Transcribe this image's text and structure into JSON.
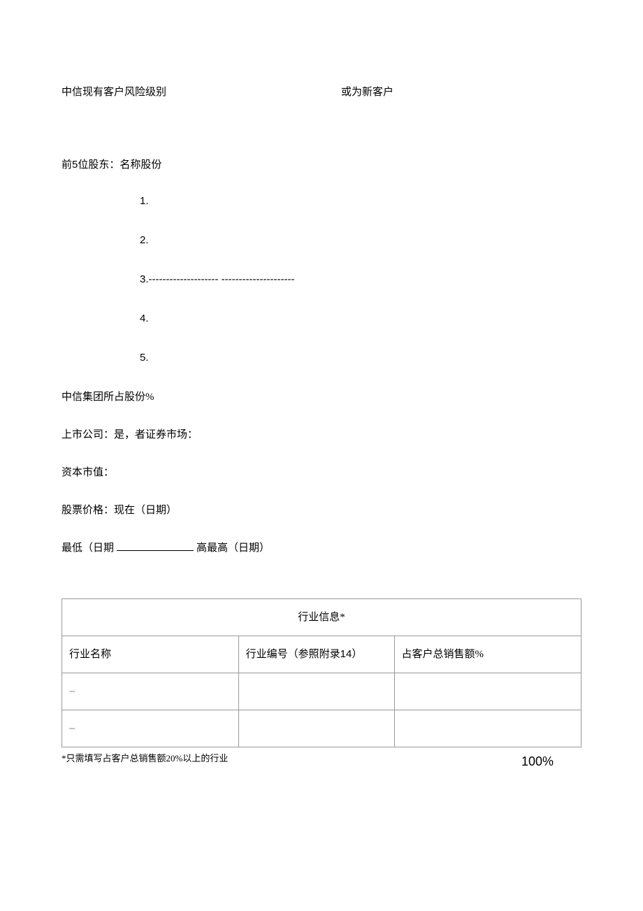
{
  "risk": {
    "left_label": "中信现有客户风险级别",
    "right_label": "或为新客户"
  },
  "shareholders": {
    "title_prefix": "前",
    "title_num": "5",
    "title_suffix": "位股东：名称股份",
    "items": [
      {
        "num": "1."
      },
      {
        "num": "2."
      },
      {
        "num": "3.",
        "line": "-------------------- ---------------------"
      },
      {
        "num": "4."
      },
      {
        "num": "5."
      }
    ]
  },
  "citic_share": "中信集团所占股份%",
  "listed_company": "上市公司：是，者证券市场：",
  "market_cap": "资本市值：",
  "stock_price": "股票价格：现在（日期）",
  "lowest_prefix": "最低（日期",
  "lowest_suffix": "高最高（日期）",
  "industry_table": {
    "header": "行业信息*",
    "col1": "行业名称",
    "col2_prefix": "行业编号（参照附录",
    "col2_num": "14",
    "col2_suffix": "）",
    "col3": "占客户总销售额%",
    "rows": [
      {
        "c1": "–",
        "c2": "",
        "c3": ""
      },
      {
        "c1": "–",
        "c2": "",
        "c3": ""
      }
    ]
  },
  "footnote": "*只需填写占客户总销售额20%以上的行业",
  "percent": "100%"
}
